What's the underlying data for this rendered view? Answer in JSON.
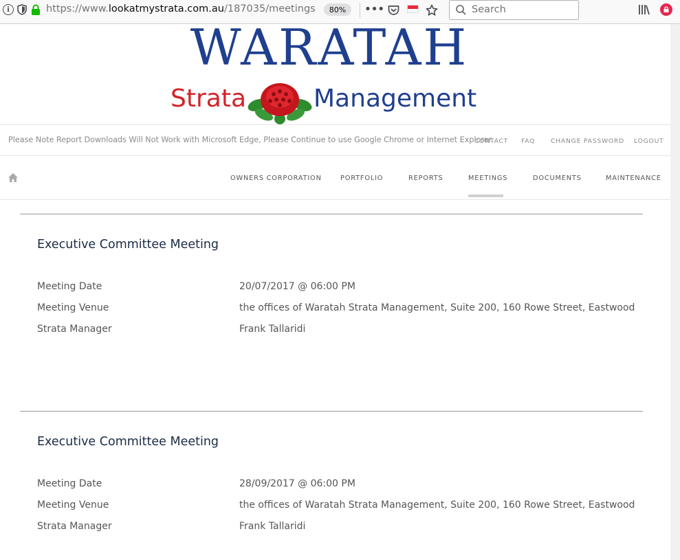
{
  "browser": {
    "url_prefix": "https://www.",
    "url_domain": "lookatmystrata.com.au",
    "url_path": "/187035/meetings",
    "zoom": "80%",
    "search_placeholder": "Search"
  },
  "logo": {
    "word": "WARATAH",
    "strata": "Strata",
    "management": "Management"
  },
  "topbar": {
    "notice": "Please Note Report Downloads Will Not Work with Microsoft Edge, Please Continue to use Google Chrome or Internet Explorer.",
    "links": [
      "CONTACT",
      "FAQ",
      "CHANGE PASSWORD",
      "LOGOUT"
    ]
  },
  "nav": {
    "items": [
      "OWNERS CORPORATION",
      "PORTFOLIO",
      "REPORTS",
      "MEETINGS",
      "DOCUMENTS",
      "MAINTENANCE"
    ],
    "active": "MEETINGS"
  },
  "meetings": [
    {
      "title": "Executive Committee Meeting",
      "fields": [
        {
          "label": "Meeting Date",
          "value": "20/07/2017 @ 06:00 PM"
        },
        {
          "label": "Meeting Venue",
          "value": "the offices of Waratah Strata Management, Suite 200, 160 Rowe Street, Eastwood"
        },
        {
          "label": "Strata Manager",
          "value": "Frank Tallaridi"
        }
      ]
    },
    {
      "title": "Executive Committee Meeting",
      "fields": [
        {
          "label": "Meeting Date",
          "value": "28/09/2017 @ 06:00 PM"
        },
        {
          "label": "Meeting Venue",
          "value": "the offices of Waratah Strata Management, Suite 200, 160 Rowe Street, Eastwood"
        },
        {
          "label": "Strata Manager",
          "value": "Frank Tallaridi"
        }
      ]
    }
  ],
  "colors": {
    "logo_blue": "#1f3f8f",
    "logo_red": "#d2232a",
    "title_navy": "#1b2b45"
  }
}
